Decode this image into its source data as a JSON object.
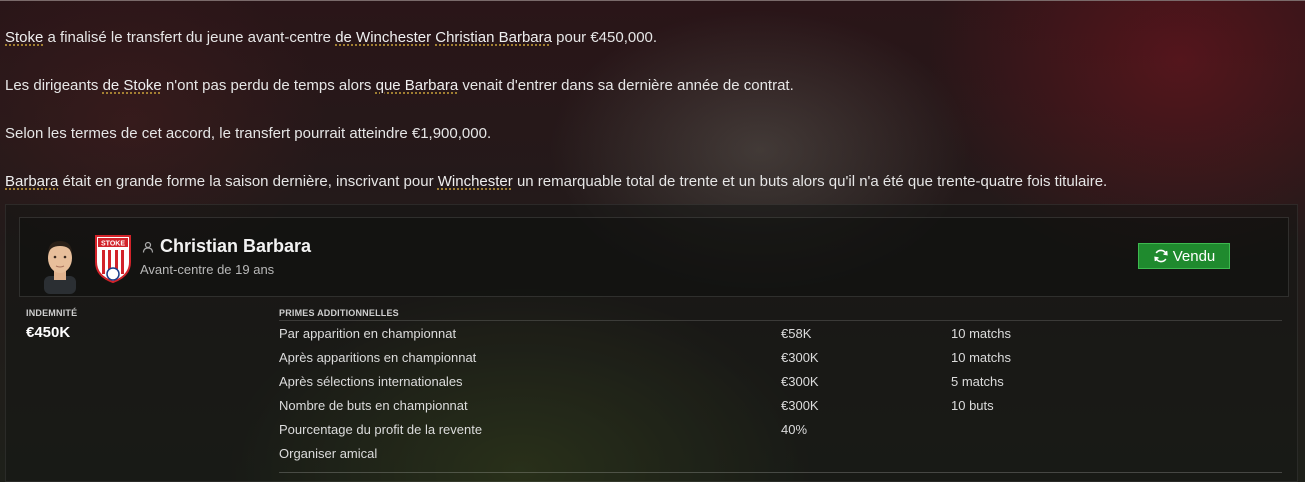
{
  "article": {
    "p1": {
      "club": "Stoke",
      "t1": " a finalisé le transfert du jeune avant-centre ",
      "from": "de Winchester",
      "t2": " ",
      "player": "Christian Barbara",
      "t3": " pour €450,000."
    },
    "p2": {
      "t1": "Les dirigeants ",
      "club": "de Stoke",
      "t2": " n'ont pas perdu de temps alors ",
      "player": "que Barbara",
      "t3": " venait d'entrer dans sa dernière année de contrat."
    },
    "p3": "Selon les termes de cet accord, le transfert pourrait atteindre €1,900,000.",
    "p4": {
      "player": "Barbara",
      "t1": " était en grande forme la saison dernière, inscrivant pour ",
      "club": "Winchester",
      "t2": " un remarquable total de trente et un buts alors qu'il n'a été que trente-quatre fois titulaire."
    }
  },
  "player": {
    "name": "Christian Barbara",
    "role": "Avant-centre de 19 ans",
    "status_button": "Vendu",
    "crest_text": "STOKE"
  },
  "fee": {
    "label": "INDEMNITÉ",
    "value": "€450K"
  },
  "bonuses": {
    "label": "PRIMES ADDITIONNELLES",
    "rows": [
      {
        "name": "Par apparition en championnat",
        "amount": "€58K",
        "condition": "10 matchs"
      },
      {
        "name": "Après apparitions en championnat",
        "amount": "€300K",
        "condition": "10 matchs"
      },
      {
        "name": "Après sélections internationales",
        "amount": "€300K",
        "condition": "5 matchs"
      },
      {
        "name": "Nombre de buts en championnat",
        "amount": "€300K",
        "condition": "10 buts"
      },
      {
        "name": "Pourcentage du profit de la revente",
        "amount": "40%",
        "condition": ""
      },
      {
        "name": "Organiser amical",
        "amount": "",
        "condition": ""
      }
    ]
  },
  "colors": {
    "accent_green": "#1f8a2e",
    "link_underline": "#c9a23a",
    "stoke_red": "#d2232a"
  }
}
